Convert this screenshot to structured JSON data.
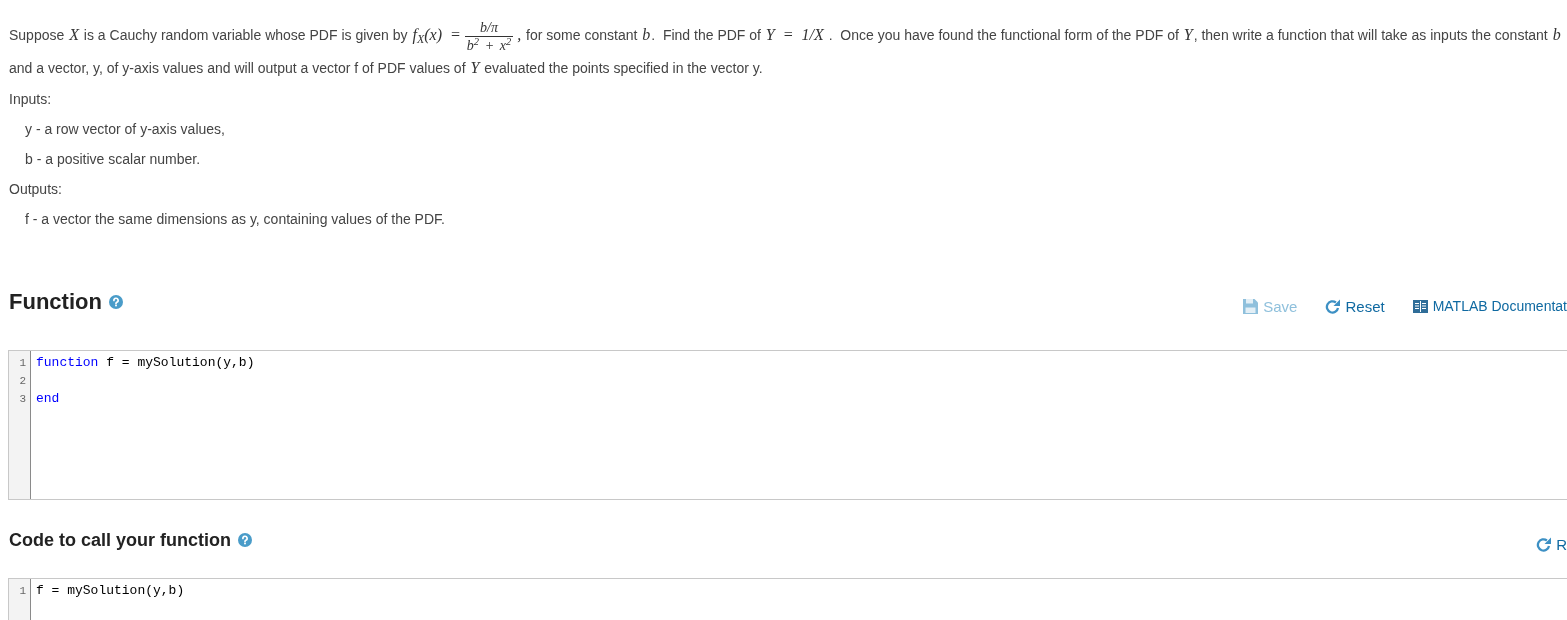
{
  "problem": {
    "statement": [
      {
        "kind": "text",
        "text": "Suppose "
      },
      {
        "kind": "math",
        "text": "X"
      },
      {
        "kind": "text",
        "text": " is a Cauchy random variable whose PDF is given by "
      },
      {
        "kind": "math",
        "text": "f$_{X}$(x) ="
      },
      {
        "kind": "fraction",
        "numerator": "b/π",
        "denominator": "b$^{2}$ + x$^{2}$"
      },
      {
        "kind": "math",
        "text": ","
      },
      {
        "kind": "text",
        "text": " for some constant "
      },
      {
        "kind": "math",
        "text": "b"
      },
      {
        "kind": "text",
        "text": ".  Find the PDF of "
      },
      {
        "kind": "math",
        "text": "Y = 1/X"
      },
      {
        "kind": "text",
        "text": " .  Once you have found the functional form of the PDF of "
      },
      {
        "kind": "math",
        "text": "Y"
      },
      {
        "kind": "text",
        "text": ", then write a function that will take as inputs the constant "
      },
      {
        "kind": "math",
        "text": "b"
      },
      {
        "kind": "text",
        "text": " and a vector, y, of y-axis values and will output a vector f of PDF values of "
      },
      {
        "kind": "math",
        "text": "Y"
      },
      {
        "kind": "text",
        "text": " evaluated the points specified in the vector y."
      }
    ],
    "inputs_label": "Inputs:",
    "inputs": [
      "y - a row vector of y-axis values,",
      "b - a positive scalar number."
    ],
    "outputs_label": "Outputs:",
    "outputs": [
      "f - a vector the same dimensions as y, containing values of the PDF."
    ]
  },
  "sections": [
    {
      "kind": "function",
      "title": "Function",
      "actions": [
        {
          "kind": "save",
          "label": "Save",
          "disabled": true
        },
        {
          "kind": "reset",
          "label": "Reset",
          "disabled": false
        },
        {
          "kind": "documentation",
          "label": "MATLAB Documentat",
          "disabled": false
        }
      ],
      "editor": {
        "lines": [
          {
            "number": "1",
            "tokens": [
              {
                "kind": "keyword",
                "text": "function"
              },
              {
                "kind": "plain",
                "text": " f = mySolution(y,b)"
              }
            ]
          },
          {
            "number": "2"
          },
          {
            "number": "3",
            "tokens": [
              {
                "kind": "keyword",
                "text": "end"
              }
            ]
          }
        ]
      }
    },
    {
      "kind": "call",
      "title": "Code to call your function",
      "actions": [
        {
          "kind": "reset",
          "label": "R",
          "disabled": false
        }
      ],
      "editor": {
        "lines": [
          {
            "number": "1",
            "tokens": [
              {
                "kind": "plain",
                "text": "f = mySolution(y,b)"
              }
            ]
          }
        ]
      }
    }
  ]
}
